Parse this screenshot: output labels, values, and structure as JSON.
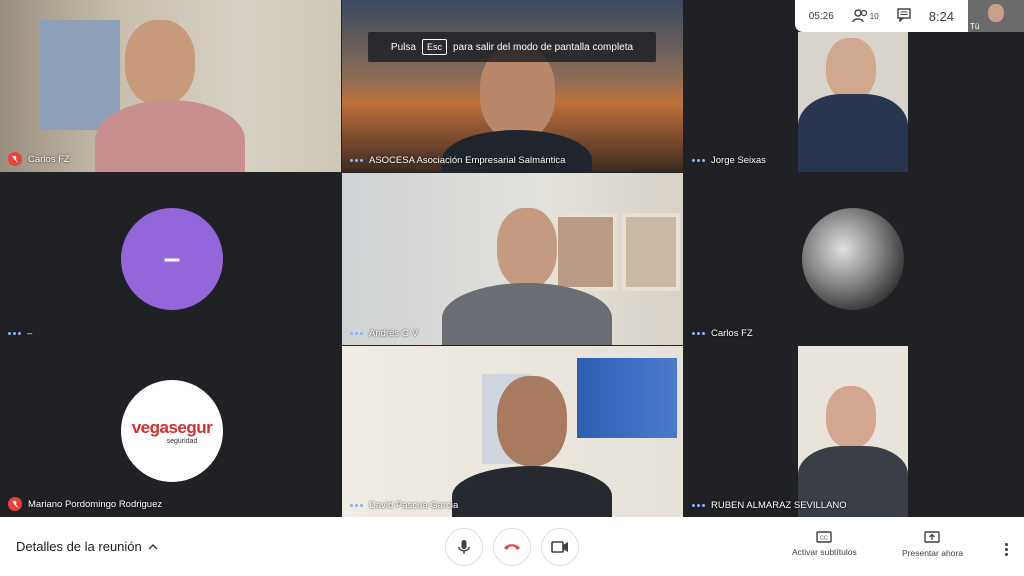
{
  "banner": {
    "prefix": "Pulsa",
    "key": "Esc",
    "suffix": "para salir del modo de pantalla completa"
  },
  "topbar": {
    "duration": "05:26",
    "participants_count": "10",
    "clock": "8:24",
    "self_label": "Tú"
  },
  "tiles": [
    {
      "name": "Carlos FZ",
      "muted": true
    },
    {
      "name": "ASOCESA Asociación Empresarial Salmántica",
      "muted": false
    },
    {
      "name": "Jorge Seixas",
      "muted": false
    },
    {
      "name": "–",
      "muted": false,
      "avatar_letter": "–"
    },
    {
      "name": "Andrés G V",
      "muted": false
    },
    {
      "name": "Carlos FZ",
      "muted": false
    },
    {
      "name": "Mariano Pordomingo Rodriguez",
      "muted": true,
      "logo_main": "vegasegur",
      "logo_sub": "seguridad"
    },
    {
      "name": "David Pascua Garcia",
      "muted": false
    },
    {
      "name": "RUBEN ALMARAZ SEVILLANO",
      "muted": false
    }
  ],
  "bottombar": {
    "details": "Detalles de la reunión",
    "captions": "Activar subtítulos",
    "present": "Presentar ahora"
  },
  "colors": {
    "accent": "#8ab4f8",
    "danger": "#ea4335",
    "purple_avatar": "#9366d9"
  }
}
